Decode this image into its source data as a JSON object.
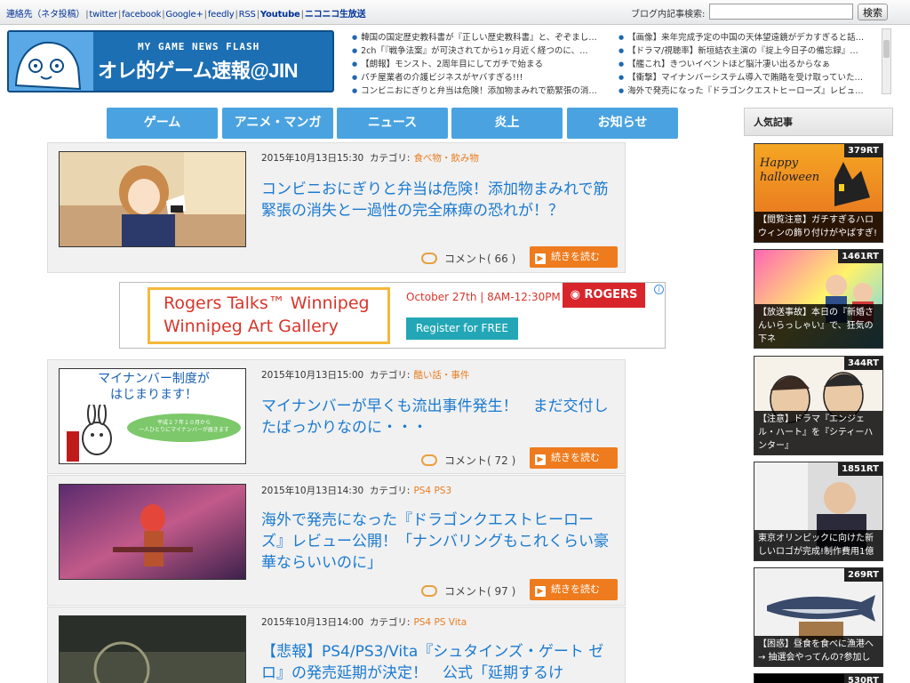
{
  "topbar": {
    "links": [
      "連絡先（ネタ投稿）",
      "twitter",
      "facebook",
      "Google+",
      "feedly",
      "RSS",
      "Youtube",
      "ニコニコ生放送"
    ],
    "search_label": "ブログ内記事検索:",
    "search_value": "",
    "search_button": "検索"
  },
  "logo": {
    "small_text": "MY GAME NEWS FLASH",
    "big_text": "オレ的ゲーム速報@JIN",
    "mascot_text": "神ゲー、神ゲー"
  },
  "headlines": {
    "left": [
      "韓国の国定歴史教科書が『正しい歴史教科書』と、ぞぞまし…",
      "2ch「『戦争法案』が可決されてから1ヶ月近く経つのに、…",
      "【朗報】モンスト、2周年目にしてガチで始まる",
      "パチ屋業者の介護ビジネスがヤバすぎる!!!",
      "コンビニおにぎりと弁当は危険！添加物まみれで筋緊張の消…"
    ],
    "right": [
      "【画像】来年完成予定の中国の天体望遠鏡がデカすぎると話…",
      "【ドラマ/視聴率】新垣結衣主演の『掟上今日子の備忘録』…",
      "【艦これ】きついイベントほど脳汁凄い出るからなぁ",
      "【衝撃】マイナンバーシステム導入で賄賂を受け取っていた…",
      "海外で発売になった『ドラゴンクエストヒーローズ』レビュ…"
    ]
  },
  "nav": {
    "tabs": [
      "ゲーム",
      "アニメ・マンガ",
      "ニュース",
      "炎上",
      "お知らせ"
    ]
  },
  "articles": [
    {
      "date": "2015年10月13日15:30",
      "cat_label": "カテゴリ:",
      "category": "食べ物・飲み物",
      "title": "コンビニおにぎりと弁当は危険！添加物まみれで筋緊張の消失と一過性の完全麻痺の恐れが！？",
      "comment_label": "コメント",
      "comments": "( 66 )",
      "read_more": "続きを読む"
    },
    {
      "date": "2015年10月13日15:00",
      "cat_label": "カテゴリ:",
      "category": "酷い話・事件",
      "title": "マイナンバーが早くも流出事件発生！　まだ交付したばっかりなのに・・・",
      "comment_label": "コメント",
      "comments": "( 72 )",
      "read_more": "続きを読む",
      "thumb_title": "マイナンバー制度が\nはじまります！",
      "thumb_caption": "平成２７年１０月から\n一人ひとりにマイナンバーが届きます"
    },
    {
      "date": "2015年10月13日14:30",
      "cat_label": "カテゴリ:",
      "category": "PS4 PS3",
      "title": "海外で発売になった『ドラゴンクエストヒーローズ』レビュー公開！「ナンバリングもこれくらい豪華ならいいのに」",
      "comment_label": "コメント",
      "comments": "( 97 )",
      "read_more": "続きを読む"
    },
    {
      "date": "2015年10月13日14:00",
      "cat_label": "カテゴリ:",
      "category": "PS4 PS Vita",
      "title": "【悲報】PS4/PS3/Vita『シュタインズ・ゲート ゼロ』の発売延期が決定！　公式「延期するけ"
    }
  ],
  "ad": {
    "line1": "Rogers Talks™ Winnipeg",
    "line2": "Winnipeg Art Gallery",
    "date": "October 27th | 8AM-12:30PM",
    "register": "Register for FREE",
    "brand": "ROGERS",
    "info": "i"
  },
  "sidebar": {
    "heading": "人気記事",
    "items": [
      {
        "rt": "379RT",
        "caption": "【閲覧注意】ガチすぎるハロウィンの飾り付けがやばすぎ!",
        "img_text": "Happy halloween"
      },
      {
        "rt": "1461RT",
        "caption": "【放送事故】本日の『新婚さんいらっしゃい』で、狂気の下ネ"
      },
      {
        "rt": "344RT",
        "caption": "【注意】ドラマ『エンジェル・ハート』を『シティーハンター』"
      },
      {
        "rt": "1851RT",
        "caption": "東京オリンピックに向けた新しいロゴが完成!制作費用1億"
      },
      {
        "rt": "269RT",
        "caption": "【困惑】昼食を食べに漁港へ → 抽選会やってんの?参加し"
      },
      {
        "rt": "530RT"
      }
    ]
  },
  "colors": {
    "nav_blue": "#4aa3e0",
    "title_blue": "#1a7ad0",
    "category_orange": "#e67e22",
    "read_more_orange": "#ee7b1d",
    "logo_blue": "#1d6fb3"
  }
}
